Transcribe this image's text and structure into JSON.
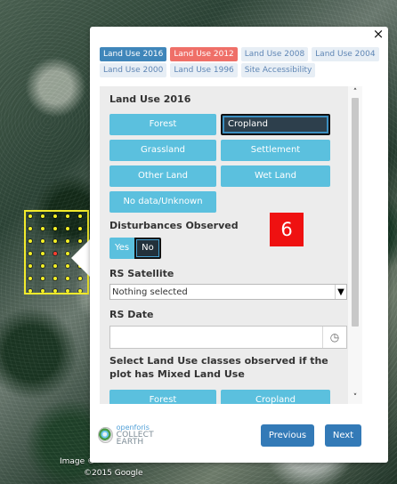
{
  "popup": {
    "close_label": "×",
    "tabs_row_1": [
      {
        "label": "Land Use 2016",
        "state": "active"
      },
      {
        "label": "Land Use 2012",
        "state": "alert"
      },
      {
        "label": "Land Use 2008",
        "state": "inactive"
      },
      {
        "label": "Land Use 2004",
        "state": "inactive"
      }
    ],
    "tabs_row_2": [
      {
        "label": "Land Use 2000",
        "state": "inactive"
      },
      {
        "label": "Land Use 1996",
        "state": "inactive"
      },
      {
        "label": "Site Accessibility",
        "state": "inactive"
      }
    ],
    "land_use": {
      "title": "Land Use 2016",
      "options": [
        {
          "label": "Forest",
          "selected": false
        },
        {
          "label": "Cropland",
          "selected": true
        },
        {
          "label": "Grassland",
          "selected": false
        },
        {
          "label": "Settlement",
          "selected": false
        },
        {
          "label": "Other Land",
          "selected": false
        },
        {
          "label": "Wet Land",
          "selected": false
        },
        {
          "label": "No data/Unknown",
          "selected": false
        }
      ]
    },
    "disturbances": {
      "title": "Disturbances Observed",
      "yes_label": "Yes",
      "no_label": "No",
      "selected": "No"
    },
    "rs_satellite": {
      "title": "RS Satellite",
      "selected_value": "Nothing selected",
      "arrow_icon": "chevron-down-icon"
    },
    "rs_date": {
      "title": "RS Date",
      "value": "",
      "icon": "clock-icon"
    },
    "mixed_land_use": {
      "title": "Select Land Use classes observed if the plot has Mixed Land Use",
      "options": [
        "Forest",
        "Cropland"
      ]
    },
    "badge": "6",
    "footer": {
      "logo_line_1": "openforis",
      "logo_line_2": "COLLECT EARTH",
      "previous_label": "Previous",
      "next_label": "Next"
    }
  },
  "map": {
    "credit_line_1": "Image ©",
    "credit_line_2": "©2015 Google"
  },
  "colors": {
    "accent": "#5bc0de",
    "selected": "#23313b",
    "tab_active": "#3f86ba",
    "tab_alert": "#ef6f68",
    "primary_button": "#337ab7",
    "badge": "#ef1111",
    "plot_outline": "#f2ea2c",
    "plot_marker": "#ff3e2f"
  }
}
